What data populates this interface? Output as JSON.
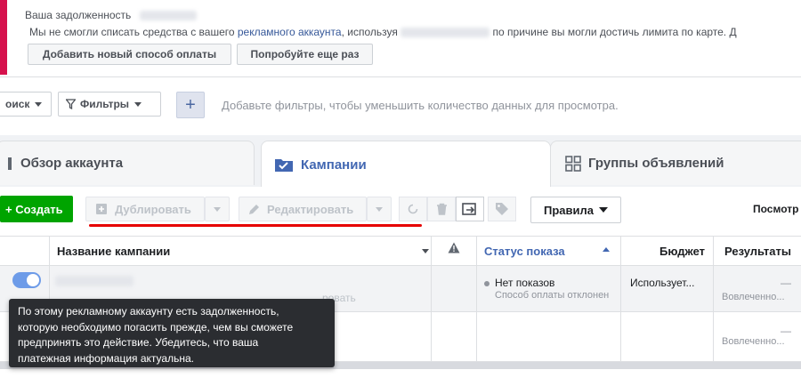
{
  "banner": {
    "title": "Ваша задолженность",
    "message_part1": "Мы не смогли списать средства с вашего",
    "account_link": "рекламного аккаунта",
    "message_part2": ", используя",
    "message_part3": "по причине вы могли достичь лимита по карте. Д",
    "add_payment_label": "Добавить новый способ оплаты",
    "retry_label": "Попробуйте еще раз",
    "accent_color": "#d6124d"
  },
  "filterbar": {
    "search_label": "оиск",
    "filters_label": "Фильтры",
    "plus_label": "+",
    "hint": "Добавьте фильтры, чтобы уменьшить количество данных для просмотра."
  },
  "tabs": [
    {
      "label": "Обзор аккаунта",
      "icon": "overview-icon"
    },
    {
      "label": "Кампании",
      "icon": "folder-icon",
      "active": true
    },
    {
      "label": "Группы объявлений",
      "icon": "grid-icon"
    }
  ],
  "toolbar": {
    "create_label": "+ Создать",
    "duplicate_label": "Дублировать",
    "edit_label": "Редактировать",
    "rules_label": "Правила",
    "view_label": "Посмотр",
    "create_color": "#00a400"
  },
  "table": {
    "columns": {
      "name": "Название кампании",
      "status": "Статус показа",
      "budget": "Бюджет",
      "results": "Результаты"
    },
    "row1": {
      "status": "Нет показов",
      "status_sub": "Способ оплаты отклонен",
      "budget": "Использует...",
      "results_dash": "—",
      "results_sub": "Вовлеченно...",
      "hidden_action": "ровать"
    },
    "row2": {
      "results_dash": "—",
      "results_sub": "Вовлеченно..."
    }
  },
  "tooltip": {
    "lines": [
      "По этому рекламному аккаунту есть задолженность,",
      "которую необходимо погасить прежде, чем вы сможете",
      "предпринять это действие. Убедитесь, что ваша",
      "платежная информация актуальна."
    ]
  }
}
